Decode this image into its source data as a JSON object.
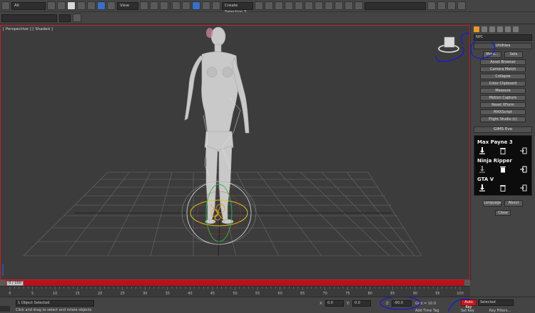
{
  "toolbar": {
    "select_filter": "All",
    "ref_coord": "View",
    "named_selection": "Create Selection S",
    "workspace": ""
  },
  "viewport": {
    "label": "[ Perspective ] [ Shaded ]"
  },
  "command_panel": {
    "search_field": "NPC",
    "utilities_title": "Utilities",
    "more_label": "More...",
    "sets_label": "Sets",
    "utility_buttons": [
      "Asset Browser",
      "Camera Match",
      "Collapse",
      "Color Clipboard",
      "Measure",
      "Motion Capture",
      "Reset XForm",
      "MAXScript",
      "Flight Studio (c)"
    ],
    "gims_title": "GIMS Evo",
    "games": [
      "Max Payne 3",
      "Ninja Ripper",
      "GTA V"
    ],
    "language_label": "Language",
    "about_label": "About",
    "close_label": "Close"
  },
  "timeline": {
    "frame_display": "0 / 100",
    "ruler_ticks": [
      "0",
      "5",
      "10",
      "15",
      "20",
      "25",
      "30",
      "35",
      "40",
      "45",
      "50",
      "55",
      "60",
      "65",
      "70",
      "75",
      "80",
      "85",
      "90",
      "95",
      "100"
    ]
  },
  "status": {
    "selection_text": "1 Object Selected",
    "prompt_text": "Click and drag to select and rotate objects",
    "x_label": "X:",
    "x_value": "0.0",
    "y_label": "Y:",
    "y_value": "0.0",
    "z_label": "Z:",
    "z_value": "-90.0",
    "grid_text": "Grid = 10.0",
    "add_time_tag": "Add Time Tag",
    "auto_key": "Auto Key",
    "selected_option": "Selected",
    "set_key": "Set Key",
    "key_filters": "Key Filters..."
  },
  "colors": {
    "accent_red": "#c8171f",
    "annotation_blue": "#1a1ad0",
    "figure_grey": "#c9c9c9"
  }
}
